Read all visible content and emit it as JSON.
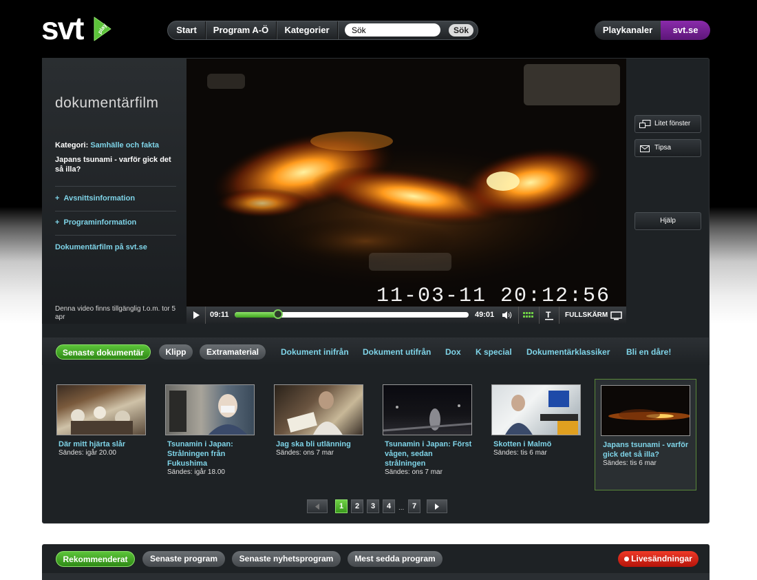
{
  "header": {
    "logo_text": "svt",
    "logo_badge": "play",
    "nav": [
      "Start",
      "Program A-Ö",
      "Kategorier"
    ],
    "search": {
      "placeholder": "Sök",
      "value": "Sök",
      "button": "Sök"
    },
    "playkanaler": "Playkanaler",
    "svtse": "svt.se"
  },
  "sidebar": {
    "category_title": "dokumentärfilm",
    "kategori_label": "Kategori:",
    "kategori_value": "Samhälle och fakta",
    "episode_title": "Japans tsunami - varför gick det så illa?",
    "links": [
      "Avsnittsinformation",
      "Programinformation"
    ],
    "program_link": "Dokumentärfilm på svt.se",
    "availability": "Denna video finns tillgänglig t.o.m. tor 5 apr"
  },
  "video": {
    "timestamp_overlay": "11-03-11 20:12:56",
    "current_time": "09:11",
    "duration": "49:01",
    "progress": 0.187,
    "fullscreen_label": "FULLSKÄRM"
  },
  "side_buttons": {
    "small_window": "Litet fönster",
    "tips": "Tipsa",
    "help": "Hjälp"
  },
  "tabs": {
    "pills": [
      "Senaste dokumentär",
      "Klipp",
      "Extramaterial"
    ],
    "links": [
      "Dokument inifrån",
      "Dokument utifrån",
      "Dox",
      "K special",
      "Dokumentärklassiker",
      "Bli en dåre!"
    ]
  },
  "episodes": [
    {
      "title": "Där mitt hjärta slår",
      "date": "Sändes: igår 20.00"
    },
    {
      "title": "Tsunamin i Japan: Strålningen från Fukushima",
      "date": "Sändes: igår 18.00"
    },
    {
      "title": "Jag ska bli utlänning",
      "date": "Sändes: ons 7 mar"
    },
    {
      "title": "Tsunamin i Japan: Först vågen, sedan strålningen",
      "date": "Sändes: ons 7 mar"
    },
    {
      "title": "Skotten i Malmö",
      "date": "Sändes: tis 6 mar"
    },
    {
      "title": "Japans tsunami - varför gick det så illa?",
      "date": "Sändes: tis 6 mar"
    }
  ],
  "pagination": {
    "pages": [
      "1",
      "2",
      "3",
      "4",
      "7"
    ],
    "ellipsis": "...",
    "active": "1"
  },
  "bottom": {
    "pills": [
      "Rekommenderat",
      "Senaste program",
      "Senaste nyhetsprogram",
      "Mest sedda program"
    ],
    "live": "Livesändningar"
  },
  "colors": {
    "accent_green": "#3fa31e",
    "link_cyan": "#7fd4e8",
    "svtse_purple": "#7a2098",
    "live_red": "#d8281a"
  }
}
